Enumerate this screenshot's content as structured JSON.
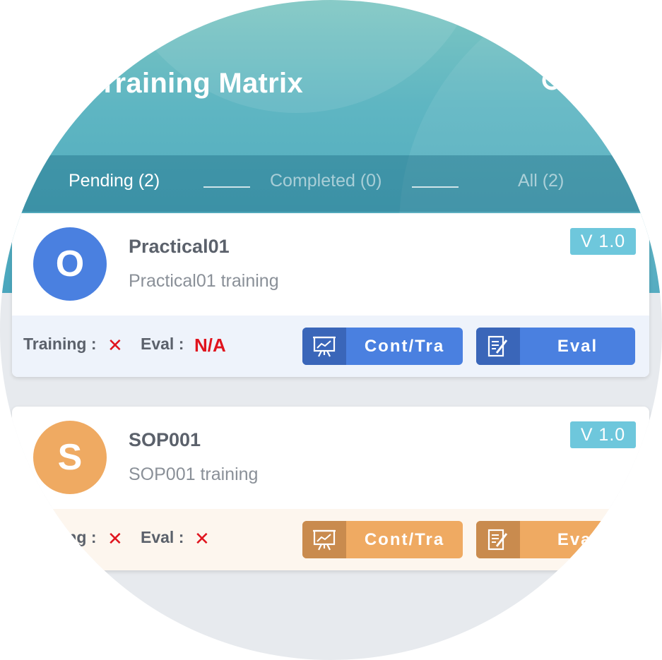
{
  "header": {
    "title": "Training Matrix",
    "search_icon": "search-icon",
    "colors": {
      "gradient_top": "#7dc6c2",
      "gradient_bottom": "#4aa6bd"
    }
  },
  "tabs": [
    {
      "label": "Pending (2)",
      "active": true
    },
    {
      "label": "Completed (0)",
      "active": false
    },
    {
      "label": "All (2)",
      "active": false
    }
  ],
  "cards": [
    {
      "avatar_letter": "O",
      "avatar_color": "#4a80e0",
      "title": "Practical01",
      "subtitle": "Practical01 training",
      "version": "V 1.0",
      "training_label": "Training :",
      "training_value": "✕",
      "eval_label": "Eval :",
      "eval_value": "N/A",
      "cont_button": "Cont/Tra",
      "eval_button": "Eval",
      "theme_color": "#4a80e0"
    },
    {
      "avatar_letter": "S",
      "avatar_color": "#efaa62",
      "title": "SOP001",
      "subtitle": "SOP001 training",
      "version": "V 1.0",
      "training_label": "Training :",
      "training_value": "✕",
      "eval_label": "Eval :",
      "eval_value": "✕",
      "cont_button": "Cont/Tra",
      "eval_button": "Eval",
      "theme_color": "#efaa62"
    }
  ]
}
